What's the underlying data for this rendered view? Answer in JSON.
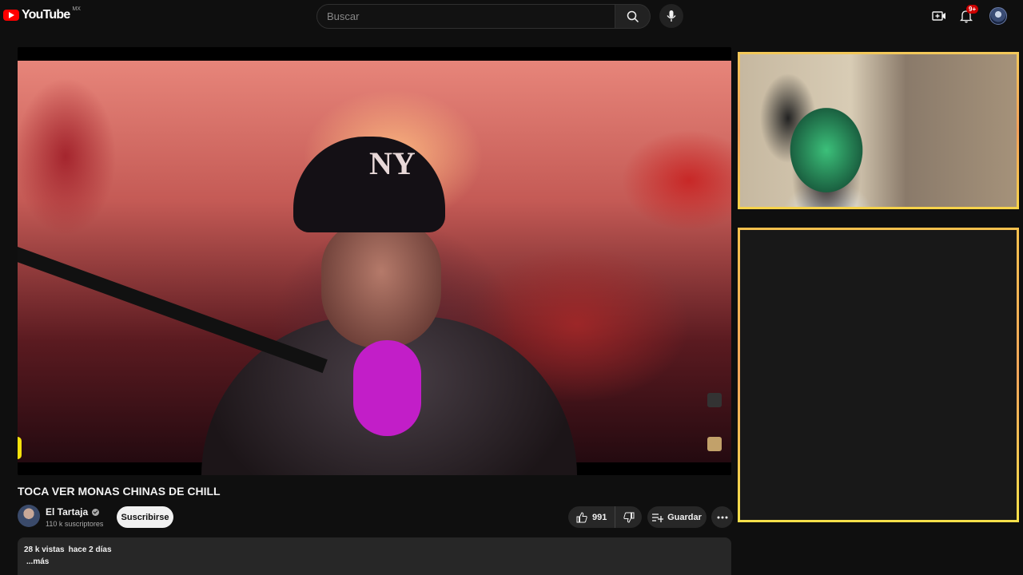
{
  "header": {
    "logo_text": "YouTube",
    "region": "MX",
    "search_placeholder": "Buscar",
    "notifications_badge": "9+"
  },
  "video": {
    "title": "TOCA VER MONAS CHINAS DE CHILL",
    "channel_name": "El Tartaja",
    "subscribers": "110 k suscriptores",
    "subscribe_label": "Suscribirse",
    "likes": "991",
    "save_label": "Guardar",
    "views": "28 k vistas",
    "published": "hace 2 días",
    "more_label": "...más"
  },
  "colors": {
    "brand_red": "#ff0000",
    "frame_gold": "#f3c85a",
    "background": "#0f0f0f"
  }
}
